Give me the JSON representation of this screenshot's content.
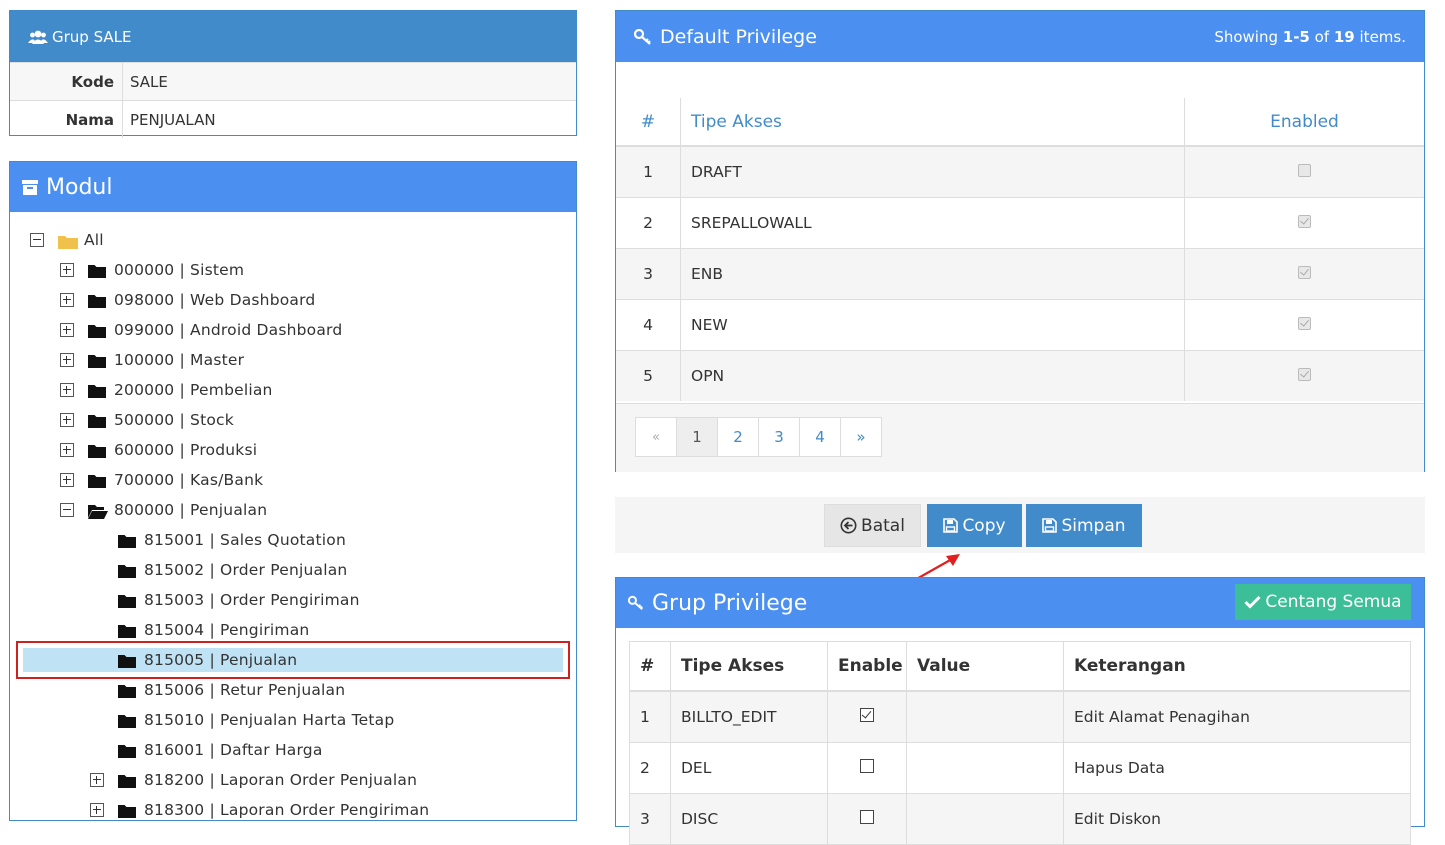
{
  "grup": {
    "title": "Grup SALE",
    "rows": [
      {
        "key": "Kode",
        "value": "SALE"
      },
      {
        "key": "Nama",
        "value": "PENJUALAN"
      }
    ]
  },
  "modul": {
    "title": "Modul",
    "tree": [
      {
        "label": "All",
        "level": 0,
        "toggle": "minus",
        "folder": "yellow"
      },
      {
        "label": "000000 | Sistem",
        "level": 1,
        "toggle": "plus",
        "folder": "closed"
      },
      {
        "label": "098000 | Web Dashboard",
        "level": 1,
        "toggle": "plus",
        "folder": "closed"
      },
      {
        "label": "099000 | Android Dashboard",
        "level": 1,
        "toggle": "plus",
        "folder": "closed"
      },
      {
        "label": "100000 | Master",
        "level": 1,
        "toggle": "plus",
        "folder": "closed"
      },
      {
        "label": "200000 | Pembelian",
        "level": 1,
        "toggle": "plus",
        "folder": "closed"
      },
      {
        "label": "500000 | Stock",
        "level": 1,
        "toggle": "plus",
        "folder": "closed"
      },
      {
        "label": "600000 | Produksi",
        "level": 1,
        "toggle": "plus",
        "folder": "closed"
      },
      {
        "label": "700000 | Kas/Bank",
        "level": 1,
        "toggle": "plus",
        "folder": "closed"
      },
      {
        "label": "800000 | Penjualan",
        "level": 1,
        "toggle": "minus",
        "folder": "open"
      },
      {
        "label": "815001 | Sales Quotation",
        "level": 2,
        "toggle": "none",
        "folder": "closed"
      },
      {
        "label": "815002 | Order Penjualan",
        "level": 2,
        "toggle": "none",
        "folder": "closed"
      },
      {
        "label": "815003 | Order Pengiriman",
        "level": 2,
        "toggle": "none",
        "folder": "closed"
      },
      {
        "label": "815004 | Pengiriman",
        "level": 2,
        "toggle": "none",
        "folder": "closed"
      },
      {
        "label": "815005 | Penjualan",
        "level": 2,
        "toggle": "none",
        "folder": "closed",
        "selected": true
      },
      {
        "label": "815006 | Retur Penjualan",
        "level": 2,
        "toggle": "none",
        "folder": "closed"
      },
      {
        "label": "815010 | Penjualan Harta Tetap",
        "level": 2,
        "toggle": "none",
        "folder": "closed"
      },
      {
        "label": "816001 | Daftar Harga",
        "level": 2,
        "toggle": "none",
        "folder": "closed"
      },
      {
        "label": "818200 | Laporan Order Penjualan",
        "level": 2,
        "toggle": "plus",
        "folder": "closed"
      },
      {
        "label": "818300 | Laporan Order Pengiriman",
        "level": 2,
        "toggle": "plus",
        "folder": "closed"
      }
    ]
  },
  "default_privilege": {
    "title": "Default Privilege",
    "summary_prefix": "Showing ",
    "summary_range": "1-5",
    "summary_of": " of ",
    "summary_total": "19",
    "summary_suffix": " items.",
    "columns": {
      "num": "#",
      "tipe": "Tipe Akses",
      "enabled": "Enabled"
    },
    "rows": [
      {
        "num": "1",
        "tipe": "DRAFT",
        "enabled": false
      },
      {
        "num": "2",
        "tipe": "SREPALLOWALL",
        "enabled": true
      },
      {
        "num": "3",
        "tipe": "ENB",
        "enabled": true
      },
      {
        "num": "4",
        "tipe": "NEW",
        "enabled": true
      },
      {
        "num": "5",
        "tipe": "OPN",
        "enabled": true
      }
    ],
    "pager": {
      "prev": "«",
      "pages": [
        "1",
        "2",
        "3",
        "4"
      ],
      "next": "»",
      "active": "1"
    }
  },
  "actions": {
    "batal": "Batal",
    "copy": "Copy",
    "simpan": "Simpan"
  },
  "grup_privilege": {
    "title": "Grup Privilege",
    "check_all": "Centang Semua",
    "columns": {
      "num": "#",
      "tipe": "Tipe Akses",
      "enable": "Enable",
      "value": "Value",
      "keterangan": "Keterangan"
    },
    "rows": [
      {
        "num": "1",
        "tipe": "BILLTO_EDIT",
        "enable": true,
        "value": "",
        "keterangan": "Edit Alamat Penagihan"
      },
      {
        "num": "2",
        "tipe": "DEL",
        "enable": false,
        "value": "",
        "keterangan": "Hapus Data"
      },
      {
        "num": "3",
        "tipe": "DISC",
        "enable": false,
        "value": "",
        "keterangan": "Edit Diskon"
      }
    ]
  },
  "colors": {
    "primary": "#428bca",
    "header": "#4b8ff0",
    "success": "#3cbf98",
    "selected": "#bfe3f5",
    "highlight": "#cc2222"
  }
}
